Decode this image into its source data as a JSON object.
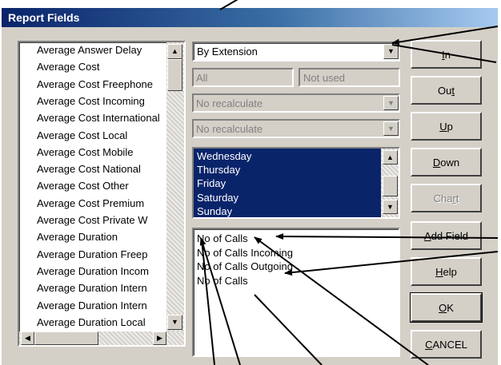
{
  "dialog": {
    "title": "Report Fields"
  },
  "field_list": {
    "items": [
      "Average Answer Delay",
      "Average Cost",
      "Average Cost Freephone",
      "Average Cost Incoming",
      "Average Cost International",
      "Average Cost Local",
      "Average Cost Mobile",
      "Average Cost National",
      "Average Cost Other",
      "Average Cost Premium",
      "Average Cost Private W",
      "Average Duration",
      "Average Duration Freep",
      "Average Duration Incom",
      "Average Duration Intern",
      "Average Duration Intern",
      "Average Duration Local"
    ]
  },
  "group_by": {
    "value": "By Extension"
  },
  "range": {
    "from": "All",
    "to": "Not used"
  },
  "recalc1": {
    "value": "No recalculate"
  },
  "recalc2": {
    "value": "No recalculate"
  },
  "days": {
    "items": [
      "Wednesday",
      "Thursday",
      "Friday",
      "Saturday",
      "Sunday"
    ]
  },
  "selected_fields": {
    "items": [
      "No of Calls",
      "No of Calls Incoming",
      "No of Calls Outgoing",
      "No of Calls"
    ]
  },
  "buttons": {
    "in": {
      "pre": "",
      "acc": "I",
      "post": "n"
    },
    "out": {
      "pre": "Ou",
      "acc": "t",
      "post": ""
    },
    "up": {
      "pre": "",
      "acc": "U",
      "post": "p"
    },
    "down": {
      "pre": "",
      "acc": "D",
      "post": "own"
    },
    "chart": {
      "pre": "Cha",
      "acc": "r",
      "post": "t"
    },
    "add_field": {
      "pre": "",
      "acc": "A",
      "post": "dd Field"
    },
    "help": {
      "pre": "",
      "acc": "H",
      "post": "elp"
    },
    "ok": {
      "pre": "",
      "acc": "O",
      "post": "K"
    },
    "cancel": {
      "pre": "",
      "acc": "C",
      "post": "ANCEL"
    }
  }
}
